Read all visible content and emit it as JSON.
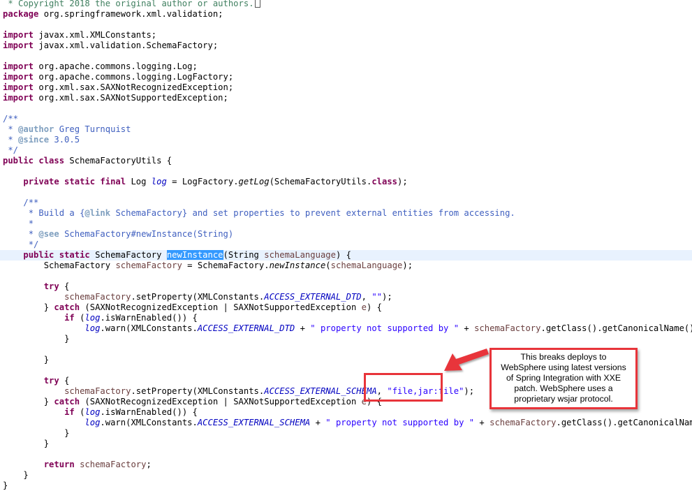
{
  "editor": {
    "lines": {
      "copyright": " * Copyright 2018 the original author or authors.",
      "package_kw": "package",
      "package_name": " org.springframework.xml.validation;",
      "import_kw": "import",
      "imp1": " javax.xml.XMLConstants;",
      "imp2": " javax.xml.validation.SchemaFactory;",
      "imp3": " org.apache.commons.logging.Log;",
      "imp4": " org.apache.commons.logging.LogFactory;",
      "imp5": " org.xml.sax.SAXNotRecognizedException;",
      "imp6": " org.xml.sax.SAXNotSupportedException;",
      "jd_open": "/**",
      "jd_star": " * ",
      "author_tag": "@author",
      "author_val": " Greg Turnquist",
      "since_tag": "@since",
      "since_val": " 3.0.5",
      "jd_close": " */",
      "class_kw": "public class",
      "class_name": " SchemaFactoryUtils {",
      "field_kw": "private static final",
      "field_type": " Log ",
      "field_name": "log",
      "field_eq": " = LogFactory.",
      "get_log": "getLog",
      "field_rest": "(SchemaFactoryUtils.",
      "class_kw2": "class",
      "field_end": ");",
      "m_jd_open": "/**",
      "m_jd_text1": " * Build a {",
      "m_jd_link": "@link",
      "m_jd_text2": " SchemaFactory} and set properties to prevent external entities from accessing.",
      "m_jd_star": " *",
      "m_jd_see_pre": " * ",
      "m_jd_see": "@see",
      "m_jd_see_val": " SchemaFactory#newInstance(String)",
      "m_jd_close": " */",
      "method_kw": "public static",
      "method_type": " SchemaFactory ",
      "method_name": "newInstance",
      "method_param_type": "(String ",
      "method_param": "schemaLanguage",
      "method_end": ") {",
      "decl_type": "SchemaFactory ",
      "decl_var": "schemaFactory",
      "decl_eq": " = SchemaFactory.",
      "decl_call": "newInstance",
      "decl_open": "(",
      "decl_arg": "schemaLanguage",
      "decl_end": ");",
      "try_kw": "try",
      "try_brace": " {",
      "set1_var": "schemaFactory",
      "set1_call": ".setProperty(XMLConstants.",
      "set1_const": "ACCESS_EXTERNAL_DTD",
      "set1_sep": ", ",
      "set1_str": "\"\"",
      "set1_end": ");",
      "catch_pre": "} ",
      "catch_kw": "catch",
      "catch_rest": " (SAXNotRecognizedException | SAXNotSupportedException ",
      "catch_e": "e",
      "catch_end": ") {",
      "if_kw": "if",
      "if_open": " (",
      "if_log": "log",
      "if_rest": ".isWarnEnabled()) {",
      "warn_log": "log",
      "warn_call": ".warn(XMLConstants.",
      "warn1_const": "ACCESS_EXTERNAL_DTD",
      "warn_plus": " + ",
      "warn_str": "\" property not supported by \"",
      "warn_plus2": " + ",
      "warn_var": "schemaFactory",
      "warn_tail": ".getClass().getCanonicalName());",
      "close_brace": "}",
      "set2_const": "ACCESS_EXTERNAL_SCHEMA",
      "set2_str": "\"file,jar:file\"",
      "warn2_const": "ACCESS_EXTERNAL_SCHEMA",
      "return_kw": "return",
      "return_val": "schemaFactory",
      "return_end": ";"
    }
  },
  "callout": {
    "line1": "This breaks deploys to",
    "line2": "WebSphere using latest versions",
    "line3": "of Spring Integration with XXE",
    "line4": "patch. WebSphere uses a",
    "line5": "proprietary wsjar protocol."
  },
  "colors": {
    "keyword": "#7f0055",
    "comment": "#3f7f5f",
    "javadoc": "#3f5fbf",
    "string": "#2a00ff",
    "static_field": "#0000c0",
    "local_variable": "#6a3e3e",
    "selection": "#3399ff",
    "current_line": "#e8f2fe",
    "annotation_red": "#e8343a"
  }
}
